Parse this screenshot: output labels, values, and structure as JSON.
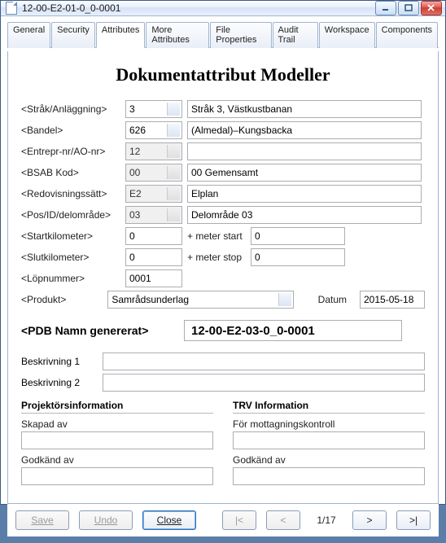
{
  "titlebar": {
    "title": "12-00-E2-01-0_0-0001"
  },
  "tabs": {
    "general": "General",
    "security": "Security",
    "attributes": "Attributes",
    "more": "More Attributes",
    "fileprops": "File Properties",
    "audit": "Audit Trail",
    "workspace": "Workspace",
    "components": "Components"
  },
  "heading": "Dokumentattribut Modeller",
  "labels": {
    "strak": "<Stråk/Anläggning>",
    "bandel": "<Bandel>",
    "entrepr": "<Entrepr-nr/AO-nr>",
    "bsab": "<BSAB Kod>",
    "redov": "<Redovisningssätt>",
    "posid": "<Pos/ID/delområde>",
    "startkm": "<Startkilometer>",
    "slutkm": "<Slutkilometer>",
    "lopn": "<Löpnummer>",
    "produkt": "<Produkt>",
    "meterstart": "+ meter start",
    "meterstop": "+ meter stop",
    "datum": "Datum",
    "gen": "<PDB Namn genererat>",
    "beskr1": "Beskrivning 1",
    "beskr2": "Beskrivning 2",
    "proj": "Projektörsinformation",
    "trv": "TRV Information",
    "skapad": "Skapad av",
    "godkand": "Godkänd av",
    "mottag": "För mottagningskontroll"
  },
  "values": {
    "strak": "3",
    "strak_desc": "Stråk 3, Västkustbanan",
    "bandel": "626",
    "bandel_desc": "(Almedal)–Kungsbacka",
    "entrepr": "12",
    "entrepr_desc": "",
    "bsab": "00",
    "bsab_desc": "00 Gemensamt",
    "redov": "E2",
    "redov_desc": "Elplan",
    "posid": "03",
    "posid_desc": "Delområde 03",
    "startkm": "0",
    "meterstart": "0",
    "slutkm": "0",
    "meterstop": "0",
    "lopn": "0001",
    "produkt": "Samrådsunderlag",
    "datum": "2015-05-18",
    "gen": "12-00-E2-03-0_0-0001",
    "beskr1": "",
    "beskr2": "",
    "skapad_av": "",
    "godkand_av_p": "",
    "mottag_val": "",
    "godkand_av_t": ""
  },
  "footer": {
    "save": "Save",
    "undo": "Undo",
    "close": "Close",
    "first": "|<",
    "prev": "<",
    "page": "1/17",
    "next": ">",
    "last": ">|"
  }
}
